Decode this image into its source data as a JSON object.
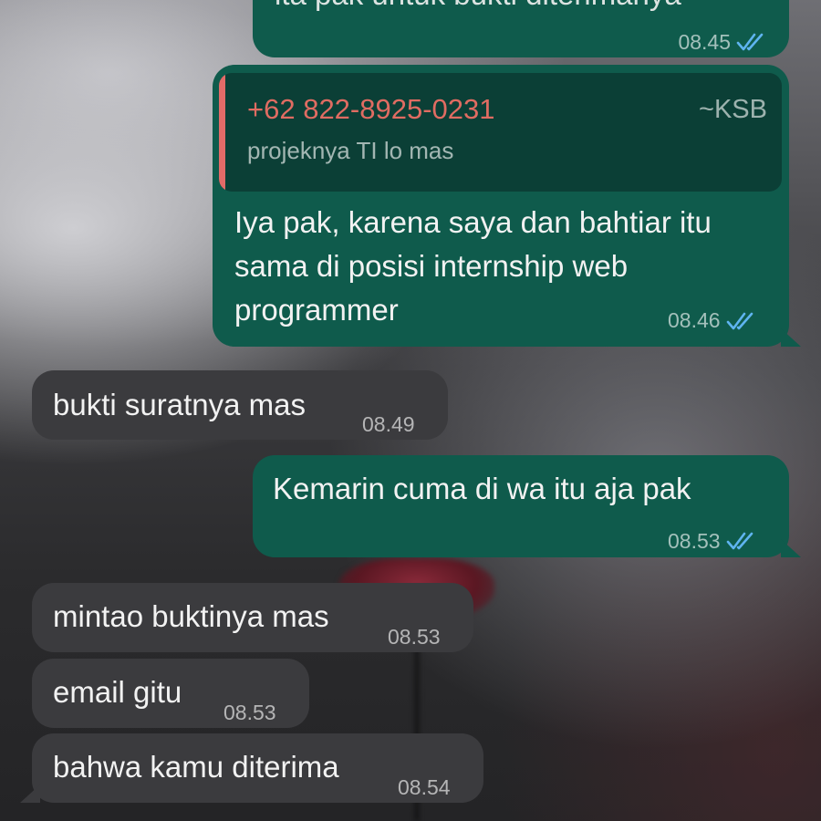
{
  "messages": [
    {
      "id": "m1",
      "direction": "out",
      "text": "ita pak untuk bukti diterimanya",
      "time": "08.45",
      "read": true
    },
    {
      "id": "m2",
      "direction": "out",
      "reply_to": {
        "sender": "+62 822-8925-0231",
        "sender_tag": "~KSB",
        "text": "projeknya TI lo mas"
      },
      "text": "Iya pak, karena saya dan bahtiar itu\nsama di posisi internship web\nprogrammer",
      "time": "08.46",
      "read": true
    },
    {
      "id": "m3",
      "direction": "in",
      "text": "bukti suratnya mas",
      "time": "08.49"
    },
    {
      "id": "m4",
      "direction": "out",
      "text": "Kemarin cuma di wa itu aja pak",
      "time": "08.53",
      "read": true
    },
    {
      "id": "m5",
      "direction": "in",
      "text": "mintao buktinya mas",
      "time": "08.53"
    },
    {
      "id": "m6",
      "direction": "in",
      "text": "email gitu",
      "time": "08.53"
    },
    {
      "id": "m7",
      "direction": "in",
      "text": "bahwa kamu diterima",
      "time": "08.54"
    }
  ],
  "colors": {
    "outgoing_bubble": "#0f5b4c",
    "incoming_bubble": "#3b3b3e",
    "quote_background": "#0b3f36",
    "quote_accent": "#e36b68",
    "read_ticks": "#5fb4f0"
  },
  "icons": {
    "read_receipt": "double-check-icon"
  }
}
